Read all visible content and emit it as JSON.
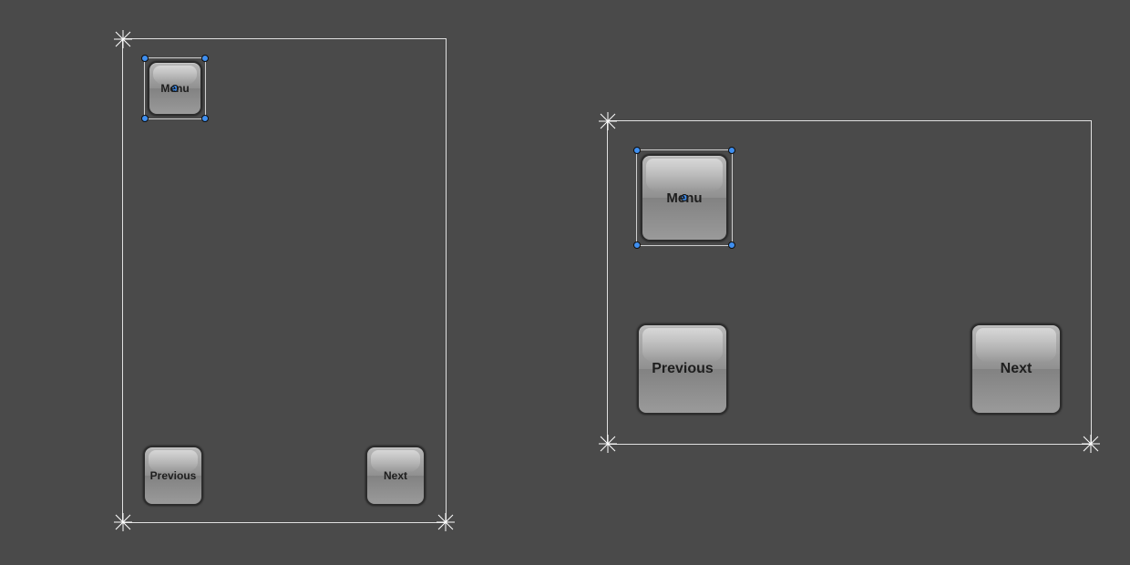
{
  "panels": {
    "left": {
      "buttons": {
        "menu_label": "Menu",
        "previous_label": "Previous",
        "next_label": "Next"
      },
      "selected": "menu"
    },
    "right": {
      "buttons": {
        "menu_label": "Menu",
        "previous_label": "Previous",
        "next_label": "Next"
      },
      "selected": "menu"
    }
  }
}
